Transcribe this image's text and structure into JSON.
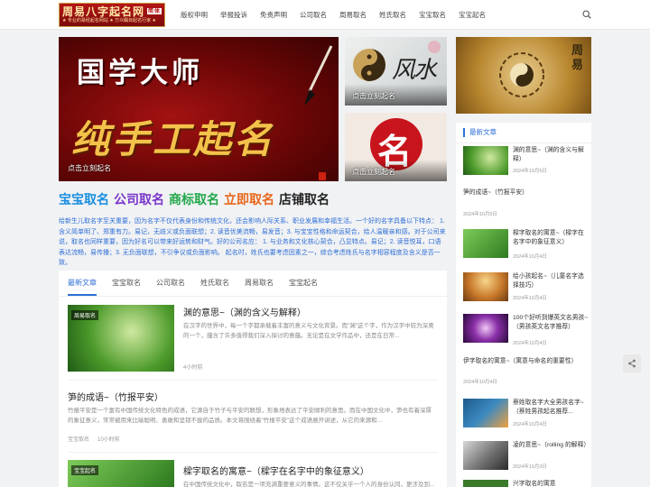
{
  "logo": {
    "title": "周易八字起名网",
    "badge": "简体",
    "tagline": "★ 专业的易经起名网站 ★ 万众瞩目起名行家 ★"
  },
  "nav": [
    "版权申明",
    "举报投诉",
    "免责声明",
    "公司取名",
    "周易取名",
    "姓氏取名",
    "宝宝取名",
    "宝宝起名"
  ],
  "hero": {
    "main_line1": "国学大师",
    "main_line2": "纯手工起名",
    "main_caption": "点击立刻起名",
    "side1_calligraphy": "风水",
    "side1_caption": "点击立刻起名",
    "side2_char": "名",
    "side2_caption": "点击立刻起名",
    "banner_text": "周易"
  },
  "categories": [
    {
      "label": "宝宝取名",
      "color": "#1a8ee0"
    },
    {
      "label": "公司取名",
      "color": "#7a35c9"
    },
    {
      "label": "商标取名",
      "color": "#22a84a"
    },
    {
      "label": "立即取名",
      "color": "#e8661a"
    },
    {
      "label": "店铺取名",
      "color": "#222222"
    }
  ],
  "intro": "给新生儿取名字至关重要，因为名字不仅代表身份和传统文化，还会影响人际关系、职业发展和幸福生活。一个好的名字具备以下特点： 1. 含义简单明了、郑重有力。易记，无歧义或负面联想；2. 读音优美流畅，易发音；3. 与宝宝性格和命运契合，给人温暖亲和感。对于公司来说，取名也同样重要，因为好名可以带来好运势和财气。好的公司名应： 1. 与业务和文化核心契合，凸显特点。易记；2. 读音悦耳，口语表达流畅，易传播；3. 无负面联想，不引争议或负面影响。 起名时，姓氏也要考虑因素之一，综合考虑姓氏与名字相容程度及含义是否一致。",
  "tabs": [
    "最新文章",
    "宝宝取名",
    "公司取名",
    "姓氏取名",
    "周易取名",
    "宝宝起名"
  ],
  "articles": [
    {
      "tag": "周易取名",
      "title": "渊的意思~（渊的含义与解释）",
      "summary": "在汉字的世界中，每一个字都承载着丰富的意义与文化背景。而\"渊\"这个字，作为汉字中较为深奥的一个，蕴含了许多值得我们深入探讨的意蕴。无论是在文学作品中，还是在日常...",
      "time": "4小时前"
    },
    {
      "tag": "",
      "title": "笋的成语~（竹报平安）",
      "summary": "竹报平安是一个富有中国传统文化特色的成语，它源自于竹子与平安的联想，形象地表达了平安顺利的意思。而在中国文化中，笋也有着深厚的象征意义，常常被用来比喻聪明、勇敢和坚韧不拔的品质。本文将围绕着\"竹报平安\"这个成语展开讲述，从它的来源和...",
      "category": "宝宝取名",
      "time": "10小时前"
    },
    {
      "tag": "宝宝起名",
      "title": "樑字取名的寓意~（樑字在名字中的象征意义）",
      "summary": "在中国传统文化中，取名是一项充满重要意义的事情。这不仅关乎一个人的身份认同，更涉及到..."
    }
  ],
  "sidebar": {
    "heading": "最新文章",
    "items": [
      {
        "title": "渊的意思~（渊的含义与解释）",
        "date": "2024年10月5日"
      },
      {
        "title": "笋的成语~（竹报平安）",
        "date": "2024年10月5日"
      },
      {
        "title": "樑字取名的寓意~（樑字在名字中的象征意义）",
        "date": "2024年10月4日"
      },
      {
        "title": "给小孩起名~（儿童名字选择技巧）",
        "date": "2024年10月4日"
      },
      {
        "title": "100个好听到爆英文名男孩~（男孩英文名字推荐）",
        "date": "2024年10月4日"
      },
      {
        "title": "伊字取名的寓意~（寓意与命名的重要性）",
        "date": "2024年10月4日"
      },
      {
        "title": "蔡姓取名字大全男孩名字~（蔡姓男孩起名推荐...",
        "date": "2024年10月4日"
      },
      {
        "title": "凌的意思~（rolling 的解释）",
        "date": "2024年10月3日"
      },
      {
        "title": "兴字取名的寓意",
        "date": ""
      }
    ]
  }
}
